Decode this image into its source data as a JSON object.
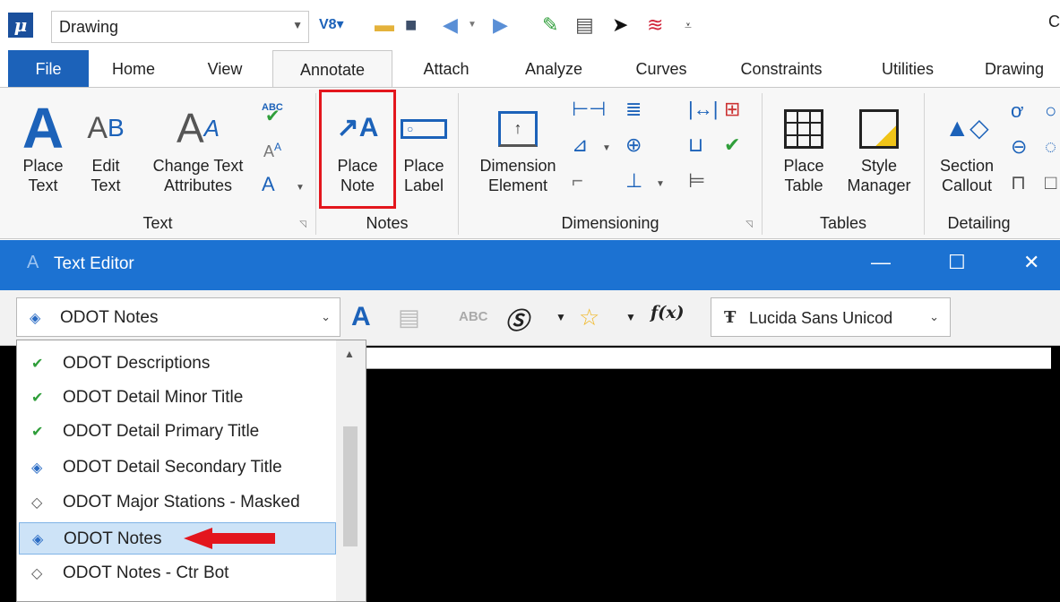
{
  "qat": {
    "workflow_value": "Drawing",
    "cut_text": "C"
  },
  "tabs": [
    "File",
    "Home",
    "View",
    "Annotate",
    "Attach",
    "Analyze",
    "Curves",
    "Constraints",
    "Utilities",
    "Drawing"
  ],
  "active_tab": "Annotate",
  "ribbon": {
    "text_group": {
      "label": "Text",
      "place_text": [
        "Place",
        "Text"
      ],
      "edit_text": [
        "Edit",
        "Text"
      ],
      "change_text_attributes": [
        "Change Text",
        "Attributes"
      ],
      "abc_glyph": "ABC"
    },
    "notes_group": {
      "label": "Notes",
      "place_note": [
        "Place",
        "Note"
      ],
      "place_label": [
        "Place",
        "Label"
      ]
    },
    "dimensioning_group": {
      "label": "Dimensioning",
      "dimension_element": [
        "Dimension",
        "Element"
      ]
    },
    "tables_group": {
      "label": "Tables",
      "place_table": [
        "Place",
        "Table"
      ],
      "style_manager": [
        "Style",
        "Manager"
      ]
    },
    "detailing_group": {
      "label": "Detailing",
      "section_callout": [
        "Section",
        "Callout"
      ]
    }
  },
  "text_editor": {
    "title": "Text Editor",
    "style_value": "ODOT Notes",
    "font_value": "Lucida Sans Unicod",
    "fx_label": "f(x)",
    "abc_label": "ABC",
    "styles": [
      {
        "label": "ODOT Descriptions",
        "icon": "check-style-icon"
      },
      {
        "label": "ODOT Detail Minor Title",
        "icon": "check-style-icon"
      },
      {
        "label": "ODOT Detail Primary Title",
        "icon": "check-style-icon"
      },
      {
        "label": "ODOT Detail Secondary Title",
        "icon": "text-style-icon"
      },
      {
        "label": "ODOT Major Stations - Masked",
        "icon": "grey-style-icon"
      },
      {
        "label": "ODOT Notes",
        "icon": "text-style-icon",
        "selected": true
      },
      {
        "label": "ODOT Notes - Ctr Bot",
        "icon": "grey-style-icon"
      }
    ]
  },
  "colors": {
    "accent": "#1c62b9",
    "title_bar": "#1c72d2",
    "highlight": "#e3161d",
    "selection": "#cde3f7"
  }
}
